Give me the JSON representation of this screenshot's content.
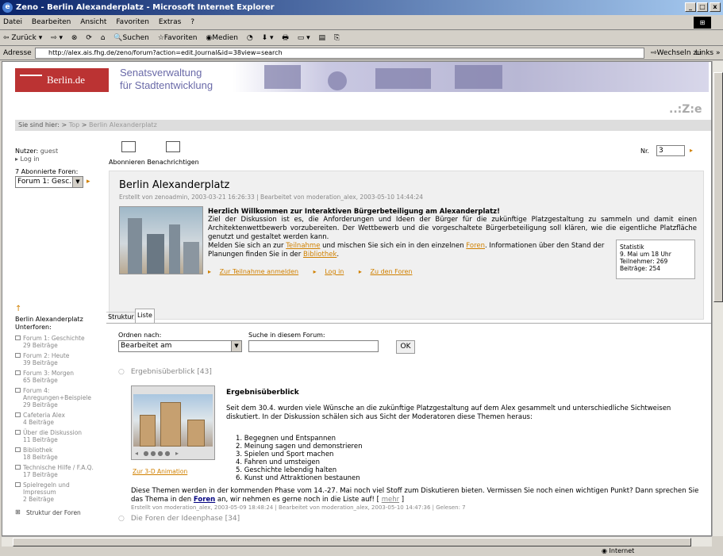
{
  "window": {
    "title": "Zeno - Berlin Alexanderplatz - Microsoft Internet Explorer",
    "min": "_",
    "max": "□",
    "close": "x",
    "win_logo": "⊞"
  },
  "menu": [
    "Datei",
    "Bearbeiten",
    "Ansicht",
    "Favoriten",
    "Extras",
    "?"
  ],
  "toolbar": [
    "⇦ Zurück ▾",
    "⇨ ▾",
    "⊗",
    "⟳",
    "⌂",
    "🔍Suchen",
    "☆Favoriten",
    "◉Medien",
    "◔",
    "⬇ ▾",
    "🖶",
    "▭ ▾",
    "▤",
    "⎘"
  ],
  "address": {
    "label": "Adresse",
    "url": "http://alex.ais.fhg.de/zeno/forum?action=edit.Journal&id=38view=search",
    "go": "⇨Wechseln zu",
    "links": "Links »"
  },
  "banner": {
    "logo": "Berlin.de",
    "senat_line1": "Senatsverwaltung",
    "senat_line2": "für Stadtentwicklung",
    "zeno": "..:Z:e"
  },
  "breadcrumb": {
    "prefix": "Sie sind hier:",
    "sep1": ">",
    "top": "Top",
    "sep2": ">",
    "current": "Berlin Alexanderplatz"
  },
  "user": {
    "label": "Nutzer:",
    "name": "guest",
    "login": "▸ Log in"
  },
  "forums": {
    "label": "7 Abonnierte Foren:",
    "selected": "Forum 1: Gesc...",
    "arrow": "▼",
    "go": "▸"
  },
  "toolbar_links": {
    "subscribe": "Abonnieren",
    "notify": "Benachrichtigen"
  },
  "nr": {
    "label": "Nr.",
    "value": "3",
    "go": "▸"
  },
  "intro": {
    "title": "Berlin Alexanderplatz",
    "meta": "Erstellt von zenoadmin, 2003-03-21 16:26:33 | Bearbeitet von moderation_alex, 2003-05-10 14:44:24",
    "heading": "Herzlich Willkommen zur Interaktiven Bürgerbeteiligung am Alexanderplatz!",
    "text": "Ziel der Diskussion ist es, die Anforderungen und Ideen der Bürger für die zukünftige Platzgestaltung zu sammeln und damit einen Architektenwettbewerb vorzubereiten. Der Wettbewerb und die vorgeschaltete Bürgerbeteiligung soll klären, wie die eigentliche Platzfläche genutzt und gestaltet werden kann.",
    "text2_a": "Melden Sie sich an zur ",
    "text2_link1": "Teilnahme",
    "text2_b": " und mischen Sie sich ein in den einzelnen ",
    "text2_link2": "Foren",
    "text2_c": ". Informationen über den Stand der Planungen finden Sie in der ",
    "text2_link3": "Bibliothek",
    "text2_d": ".",
    "link_signup": "Zur Teilnahme anmelden",
    "link_login": "Log in",
    "link_forums": "Zu den Foren",
    "link_arrow": "▸"
  },
  "stats": {
    "title": "Statistik",
    "date": "9. Mai um 18 Uhr",
    "participants": "Teilnehmer: 269",
    "posts": "Beiträge: 254"
  },
  "lower_nav": {
    "up": "↑",
    "title": "Berlin Alexanderplatz Unterforen:",
    "items": [
      {
        "name": "Forum 1: Geschichte",
        "count": "29 Beiträge"
      },
      {
        "name": "Forum 2: Heute",
        "count": "39 Beiträge"
      },
      {
        "name": "Forum 3: Morgen",
        "count": "65 Beiträge"
      },
      {
        "name": "Forum 4: Anregungen+Beispiele",
        "count": "29 Beiträge"
      },
      {
        "name": "Cafeteria Alex",
        "count": "4 Beiträge"
      },
      {
        "name": "Über die Diskussion",
        "count": "11 Beiträge"
      },
      {
        "name": "Bibliothek",
        "count": "18 Beiträge"
      },
      {
        "name": "Technische Hilfe / F.A.Q.",
        "count": "17 Beiträge"
      },
      {
        "name": "Spielregeln und Impressum",
        "count": "2 Beiträge"
      }
    ],
    "structure": "Struktur der Foren"
  },
  "tabs": {
    "struktur": "Struktur",
    "liste": "Liste"
  },
  "order": {
    "label": "Ordnen nach:",
    "selected": "Bearbeitet am",
    "arrow": "▼"
  },
  "search": {
    "label": "Suche in diesem Forum:",
    "value": "",
    "ok": "OK"
  },
  "result1": {
    "bullet": "○",
    "title": "Ergebnisüberblick",
    "count": "[43]",
    "img_link": "Zur 3-D Animation",
    "heading": "Ergebnisüberblick",
    "text": "Seit dem 30.4. wurden viele Wünsche an die zukünftige Platzgestaltung auf dem Alex gesammelt und unterschiedliche Sichtweisen diskutiert. In der Diskussion schälen sich aus Sicht der Moderatoren diese Themen heraus:",
    "list": [
      "1.  Begegnen und Entspannen",
      "2.  Meinung sagen und demonstrieren",
      "3.  Spielen und Sport machen",
      "4.  Fahren und umsteigen",
      "5.  Geschichte lebendig halten",
      "6.  Kunst und Attraktionen bestaunen"
    ],
    "foot_a": "Diese Themen werden in der kommenden Phase vom 14.-27. Mai noch viel Stoff zum Diskutieren bieten. Vermissen Sie noch einen wichtigen Punkt? Dann sprechen Sie das Thema in den ",
    "foot_link": "Foren",
    "foot_b": " an, wir nehmen es gerne noch in die Liste auf! [ ",
    "foot_more": "mehr",
    "foot_c": " ]",
    "meta": "Erstellt von moderation_alex, 2003-05-09 18:48:24 | Bearbeitet von moderation_alex, 2003-05-10 14:47:36 | Gelesen: 7"
  },
  "result2": {
    "bullet": "○",
    "title": "Die Foren der Ideenphase",
    "count": "[34]"
  },
  "status": {
    "left": "",
    "zone": "◉ Internet"
  }
}
